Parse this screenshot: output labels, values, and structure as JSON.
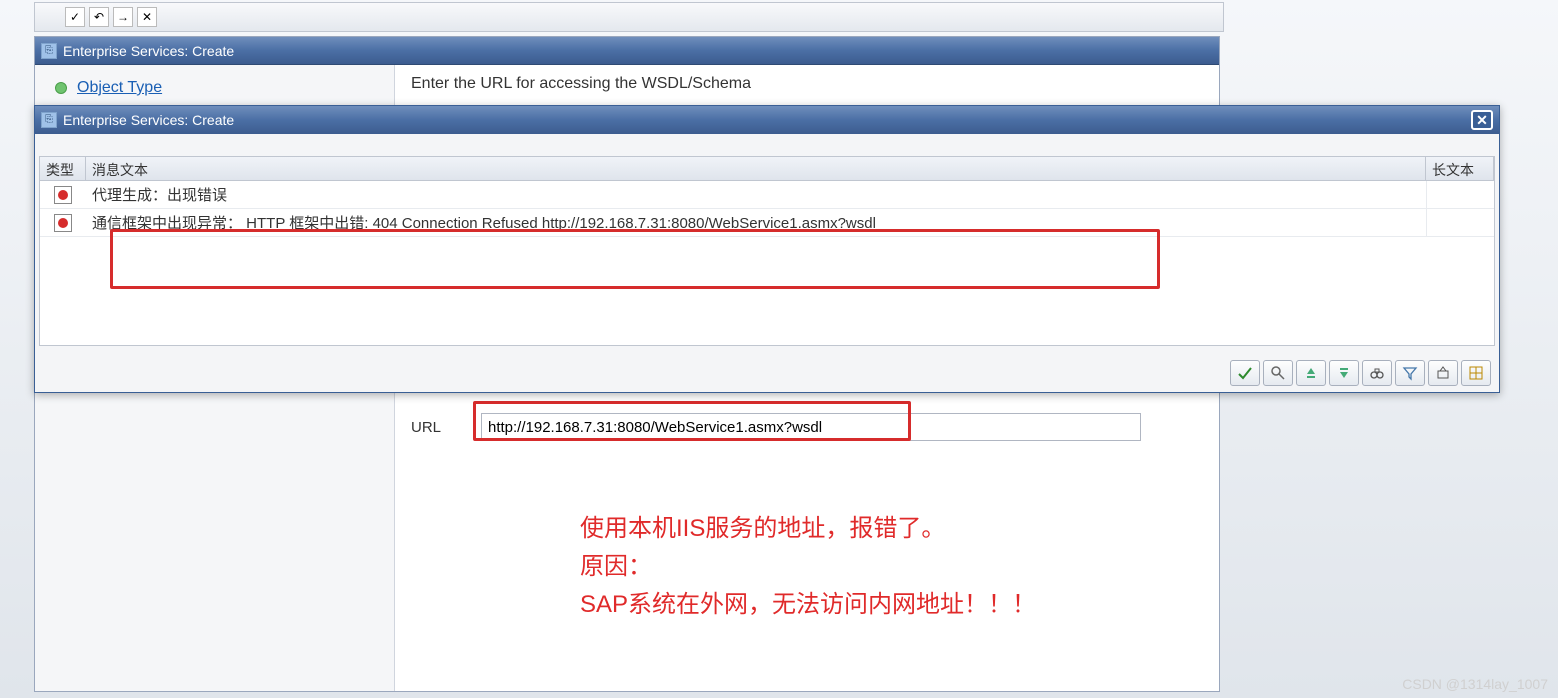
{
  "toolbar_icons": [
    "✓",
    "↶",
    "→",
    "✕"
  ],
  "window_back": {
    "title": "Enterprise Services: Create",
    "sidebar_item": "Object Type",
    "main_hint": "Enter the URL for accessing the WSDL/Schema",
    "url_label": "URL",
    "url_value": "http://192.168.7.31:8080/WebService1.asmx?wsdl"
  },
  "window_front": {
    "title": "Enterprise Services: Create",
    "columns": {
      "type": "类型",
      "msg": "消息文本",
      "long": "长文本"
    },
    "rows": [
      {
        "msg": "代理生成：出现错误"
      },
      {
        "msg": "通信框架中出现异常： HTTP 框架中出错: 404  Connection Refused http://192.168.7.31:8080/WebService1.asmx?wsdl"
      }
    ],
    "toolbar": [
      "check",
      "find",
      "sort-asc",
      "sort-desc",
      "binoculars",
      "filter",
      "export",
      "grid"
    ]
  },
  "annotation": {
    "line1": "使用本机IIS服务的地址，报错了。",
    "line2": "原因：",
    "line3": "SAP系统在外网，无法访问内网地址！！！"
  },
  "watermark": "CSDN @1314lay_1007"
}
